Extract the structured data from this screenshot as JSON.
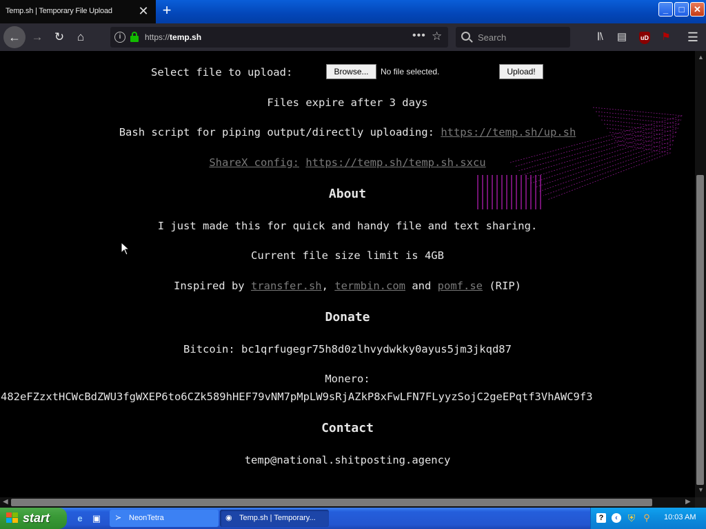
{
  "browser": {
    "tab_title": "Temp.sh | Temporary File Upload",
    "tab_close": "✕",
    "new_tab": "+",
    "url_prefix": "https://",
    "url_host": "temp.sh",
    "search_placeholder": "Search",
    "icons": [
      "back-arrow-icon",
      "forward-arrow-icon",
      "reload-icon",
      "home-icon",
      "info-icon",
      "lock-icon",
      "more-dots-icon",
      "bookmark-star-icon",
      "search-icon",
      "library-icon",
      "sidebar-icon",
      "ublock-icon",
      "extension-icon",
      "hamburger-menu-icon"
    ],
    "ublock_label": "uD"
  },
  "window": {
    "min": "_",
    "max": "□",
    "close": "✕"
  },
  "page": {
    "upload_label": "Select file to upload:",
    "browse_label": "Browse...",
    "no_file": "No file selected.",
    "upload_button": "Upload!",
    "expire": "Files expire after 3 days",
    "bash_text": "Bash script for piping output/directly uploading:",
    "bash_link": "https://temp.sh/up.sh",
    "sharex_label": "ShareX config:",
    "sharex_link": "https://temp.sh/temp.sh.sxcu",
    "about_heading": "About",
    "about_text": "I just made this for quick and handy file and text sharing.",
    "size_limit": "Current file size limit is 4GB",
    "inspired_prefix": "Inspired by",
    "inspired_link1": "transfer.sh",
    "comma": ",",
    "inspired_link2": "termbin.com",
    "and": "and",
    "inspired_link3": "pomf.se",
    "rip": "(RIP)",
    "donate_heading": "Donate",
    "bitcoin": "Bitcoin: bc1qrfugegr75h8d0zlhvydwkky0ayus5jm3jkqd87",
    "monero_label": "Monero:",
    "monero_addr": "482eFZzxtHCWcBdZWU3fgWXEP6to6CZk589hHEF79vNM7pMpLW9sRjAZkP8xFwLFN7FLyyzSojC2geEPqtf3VhAWC9f3",
    "contact_heading": "Contact",
    "contact_email": "temp@national.shitposting.agency"
  },
  "taskbar": {
    "start_label": "start",
    "tasks": [
      {
        "label": "NeonTetra",
        "icon": "fish-icon"
      },
      {
        "label": "Temp.sh | Temporary...",
        "icon": "firefox-icon"
      }
    ],
    "quicklaunch": [
      "internet-explorer-icon",
      "show-desktop-icon"
    ],
    "tray_icons": [
      "help-icon",
      "chevron-icon",
      "security-shield-icon",
      "key-icon"
    ],
    "clock": "10:03 AM"
  },
  "colors": {
    "page_bg": "#000000",
    "text": "#e6e6e6",
    "link": "#7a7a7a",
    "art_magenta": "#c020c0",
    "navbar": "#2b2a33",
    "taskbar_blue": "#245edb",
    "start_green": "#3a9a37"
  }
}
